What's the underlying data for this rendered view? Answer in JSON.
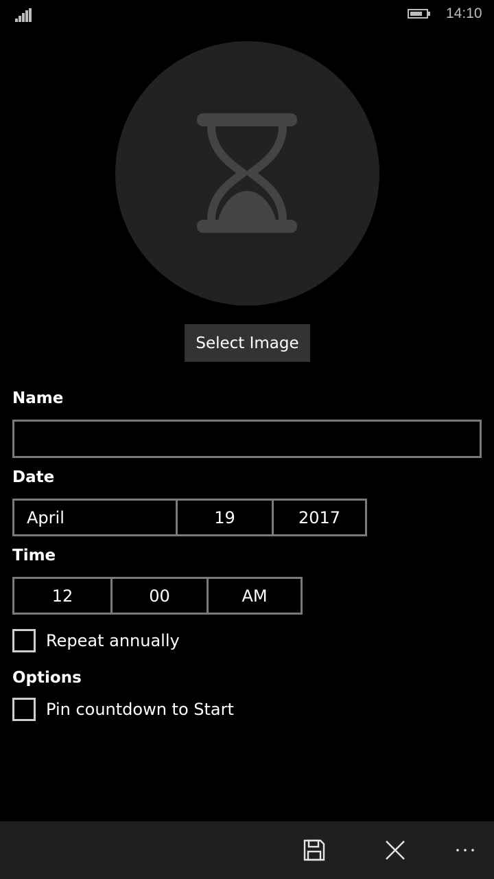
{
  "status_bar": {
    "time": "14:10",
    "signal_bars": 5,
    "battery_level": 0.75,
    "icons": [
      "signal-icon",
      "battery-icon"
    ]
  },
  "avatar": {
    "icon": "hourglass-icon"
  },
  "select_image_label": "Select Image",
  "name": {
    "label": "Name",
    "value": ""
  },
  "date": {
    "label": "Date",
    "month": "April",
    "day": "19",
    "year": "2017"
  },
  "time": {
    "label": "Time",
    "hour": "12",
    "minute": "00",
    "ampm": "AM"
  },
  "repeat": {
    "label": "Repeat annually",
    "checked": false
  },
  "options": {
    "heading": "Options",
    "pin": {
      "label": "Pin countdown to Start",
      "checked": false
    }
  },
  "app_bar": {
    "icons": [
      "save-icon",
      "close-icon",
      "more-icon"
    ]
  },
  "colors": {
    "background": "#000000",
    "avatar": "#222222",
    "button": "#333333",
    "border": "#7a7a7a",
    "appbar": "#1f1f1f"
  }
}
